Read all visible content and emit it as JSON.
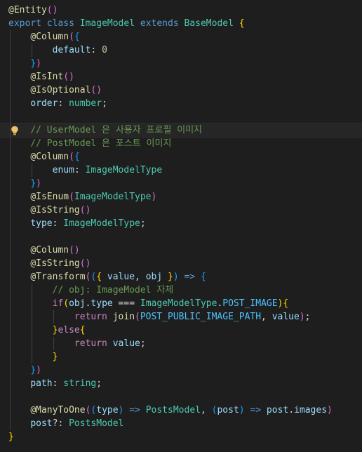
{
  "editor": {
    "lines": [
      {
        "indent": 0,
        "tokens": [
          [
            "ann",
            "@Entity"
          ],
          [
            "b2",
            "()"
          ]
        ]
      },
      {
        "indent": 0,
        "tokens": [
          [
            "kw",
            "export"
          ],
          [
            "pl",
            " "
          ],
          [
            "kw",
            "class"
          ],
          [
            "pl",
            " "
          ],
          [
            "cls",
            "ImageModel"
          ],
          [
            "pl",
            " "
          ],
          [
            "kw",
            "extends"
          ],
          [
            "pl",
            " "
          ],
          [
            "cls",
            "BaseModel"
          ],
          [
            "pl",
            " "
          ],
          [
            "b1",
            "{"
          ]
        ]
      },
      {
        "indent": 1,
        "tokens": [
          [
            "ann",
            "@Column"
          ],
          [
            "b2",
            "("
          ],
          [
            "b3",
            "{"
          ]
        ]
      },
      {
        "indent": 2,
        "tokens": [
          [
            "prop",
            "default"
          ],
          [
            "pl",
            ": "
          ],
          [
            "num",
            "0"
          ]
        ]
      },
      {
        "indent": 1,
        "tokens": [
          [
            "b3",
            "}"
          ],
          [
            "b2",
            ")"
          ]
        ]
      },
      {
        "indent": 1,
        "tokens": [
          [
            "ann",
            "@IsInt"
          ],
          [
            "b2",
            "()"
          ]
        ]
      },
      {
        "indent": 1,
        "tokens": [
          [
            "ann",
            "@IsOptional"
          ],
          [
            "b2",
            "()"
          ]
        ]
      },
      {
        "indent": 1,
        "tokens": [
          [
            "prop",
            "order"
          ],
          [
            "pl",
            ": "
          ],
          [
            "cls",
            "number"
          ],
          [
            "pl",
            ";"
          ]
        ]
      },
      {
        "indent": 1,
        "tokens": []
      },
      {
        "indent": 1,
        "current": true,
        "bulb": true,
        "tokens": [
          [
            "com",
            "// UserModel 은 사용자 프로필 이미지"
          ]
        ]
      },
      {
        "indent": 1,
        "tokens": [
          [
            "com",
            "// PostModel 은 포스트 이미지"
          ]
        ]
      },
      {
        "indent": 1,
        "tokens": [
          [
            "ann",
            "@Column"
          ],
          [
            "b2",
            "("
          ],
          [
            "b3",
            "{"
          ]
        ]
      },
      {
        "indent": 2,
        "tokens": [
          [
            "prop",
            "enum"
          ],
          [
            "pl",
            ": "
          ],
          [
            "cls",
            "ImageModelType"
          ]
        ]
      },
      {
        "indent": 1,
        "tokens": [
          [
            "b3",
            "}"
          ],
          [
            "b2",
            ")"
          ]
        ]
      },
      {
        "indent": 1,
        "tokens": [
          [
            "ann",
            "@IsEnum"
          ],
          [
            "b2",
            "("
          ],
          [
            "cls",
            "ImageModelType"
          ],
          [
            "b2",
            ")"
          ]
        ]
      },
      {
        "indent": 1,
        "tokens": [
          [
            "ann",
            "@IsString"
          ],
          [
            "b2",
            "()"
          ]
        ]
      },
      {
        "indent": 1,
        "tokens": [
          [
            "prop",
            "type"
          ],
          [
            "pl",
            ": "
          ],
          [
            "cls",
            "ImageModelType"
          ],
          [
            "pl",
            ";"
          ]
        ]
      },
      {
        "indent": 1,
        "tokens": []
      },
      {
        "indent": 1,
        "tokens": [
          [
            "ann",
            "@Column"
          ],
          [
            "b2",
            "()"
          ]
        ]
      },
      {
        "indent": 1,
        "tokens": [
          [
            "ann",
            "@IsString"
          ],
          [
            "b2",
            "()"
          ]
        ]
      },
      {
        "indent": 1,
        "tokens": [
          [
            "ann",
            "@Transform"
          ],
          [
            "b2",
            "("
          ],
          [
            "b3",
            "("
          ],
          [
            "b1",
            "{"
          ],
          [
            "pl",
            " "
          ],
          [
            "prop",
            "value"
          ],
          [
            "pl",
            ", "
          ],
          [
            "prop",
            "obj"
          ],
          [
            "pl",
            " "
          ],
          [
            "b1",
            "}"
          ],
          [
            "b3",
            ")"
          ],
          [
            "pl",
            " "
          ],
          [
            "kw",
            "=>"
          ],
          [
            "pl",
            " "
          ],
          [
            "b3",
            "{"
          ]
        ]
      },
      {
        "indent": 2,
        "tokens": [
          [
            "com",
            "// obj: ImageModel 자체"
          ]
        ]
      },
      {
        "indent": 2,
        "tokens": [
          [
            "ctrl",
            "if"
          ],
          [
            "b1",
            "("
          ],
          [
            "prop",
            "obj"
          ],
          [
            "pl",
            "."
          ],
          [
            "prop",
            "type"
          ],
          [
            "pl",
            " === "
          ],
          [
            "cls",
            "ImageModelType"
          ],
          [
            "pl",
            "."
          ],
          [
            "var",
            "POST_IMAGE"
          ],
          [
            "b1",
            ")"
          ],
          [
            "b1",
            "{"
          ]
        ]
      },
      {
        "indent": 3,
        "tokens": [
          [
            "ctrl",
            "return"
          ],
          [
            "pl",
            " "
          ],
          [
            "ann",
            "join"
          ],
          [
            "b2",
            "("
          ],
          [
            "var",
            "POST_PUBLIC_IMAGE_PATH"
          ],
          [
            "pl",
            ", "
          ],
          [
            "prop",
            "value"
          ],
          [
            "b2",
            ")"
          ],
          [
            "pl",
            ";"
          ]
        ]
      },
      {
        "indent": 2,
        "tokens": [
          [
            "b1",
            "}"
          ],
          [
            "ctrl",
            "else"
          ],
          [
            "b1",
            "{"
          ]
        ]
      },
      {
        "indent": 3,
        "tokens": [
          [
            "ctrl",
            "return"
          ],
          [
            "pl",
            " "
          ],
          [
            "prop",
            "value"
          ],
          [
            "pl",
            ";"
          ]
        ]
      },
      {
        "indent": 2,
        "tokens": [
          [
            "b1",
            "}"
          ]
        ]
      },
      {
        "indent": 1,
        "tokens": [
          [
            "b3",
            "}"
          ],
          [
            "b2",
            ")"
          ]
        ]
      },
      {
        "indent": 1,
        "tokens": [
          [
            "prop",
            "path"
          ],
          [
            "pl",
            ": "
          ],
          [
            "cls",
            "string"
          ],
          [
            "pl",
            ";"
          ]
        ]
      },
      {
        "indent": 1,
        "tokens": []
      },
      {
        "indent": 1,
        "tokens": [
          [
            "ann",
            "@ManyToOne"
          ],
          [
            "b2",
            "("
          ],
          [
            "b3",
            "("
          ],
          [
            "prop",
            "type"
          ],
          [
            "b3",
            ")"
          ],
          [
            "pl",
            " "
          ],
          [
            "kw",
            "=>"
          ],
          [
            "pl",
            " "
          ],
          [
            "cls",
            "PostsModel"
          ],
          [
            "pl",
            ", "
          ],
          [
            "b3",
            "("
          ],
          [
            "prop",
            "post"
          ],
          [
            "b3",
            ")"
          ],
          [
            "pl",
            " "
          ],
          [
            "kw",
            "=>"
          ],
          [
            "pl",
            " "
          ],
          [
            "prop",
            "post"
          ],
          [
            "pl",
            "."
          ],
          [
            "prop",
            "images"
          ],
          [
            "b2",
            ")"
          ]
        ]
      },
      {
        "indent": 1,
        "tokens": [
          [
            "prop",
            "post"
          ],
          [
            "pl",
            "?: "
          ],
          [
            "cls",
            "PostsModel"
          ]
        ]
      },
      {
        "indent": 0,
        "tokens": [
          [
            "b1",
            "}"
          ]
        ]
      }
    ]
  }
}
